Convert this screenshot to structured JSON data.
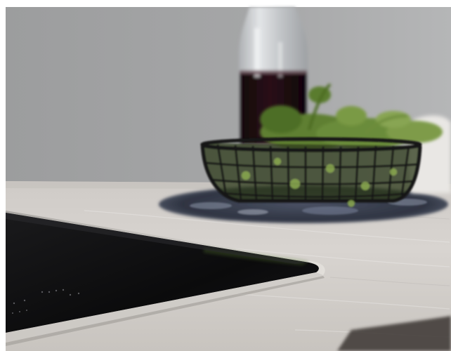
{
  "image": {
    "subject": "kitchen-induction-hob-scene",
    "objects": [
      "induction-cooktop",
      "stone-countertop",
      "dark-bottle",
      "wire-basket",
      "herbs",
      "slate-trivet",
      "wall"
    ]
  },
  "colors": {
    "wall": "#9a9b9c",
    "wall_light": "#b6b7b8",
    "countertop": "#d7d3cf",
    "countertop_shadow": "#b9b5b1",
    "cooktop": "#0c0c0d",
    "cooktop_edge": "#c9c6c2",
    "bottle_glass": "#c9cccf",
    "bottle_liquid": "#1a0b10",
    "basket": "#1b1c1d",
    "herb_green": "#6f8f3c",
    "herb_dark": "#3c5a22",
    "trivet": "#3a4150"
  }
}
